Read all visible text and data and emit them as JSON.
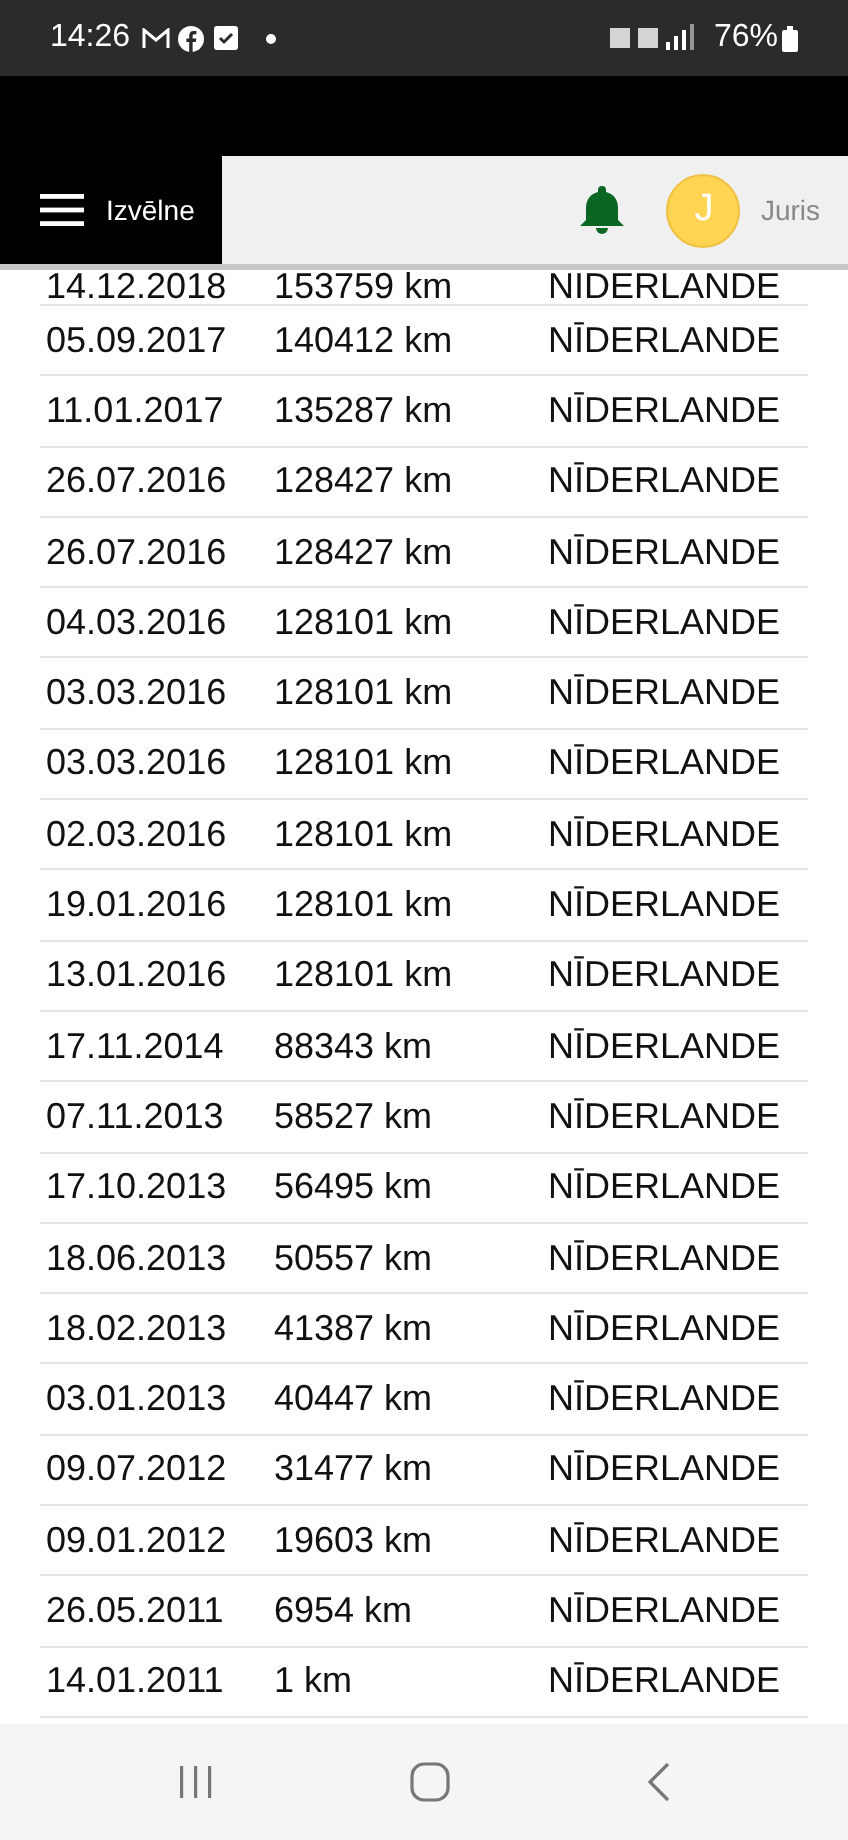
{
  "status_bar": {
    "time": "14:26",
    "battery": "76%"
  },
  "header": {
    "menu_label": "Izvēlne",
    "avatar_initial": "J",
    "user_name": "Juris"
  },
  "rows": [
    {
      "date": "14.12.2018",
      "odometer": "153759 km",
      "country": "NIDERLANDE"
    },
    {
      "date": "05.09.2017",
      "odometer": "140412 km",
      "country": "NĪDERLANDE"
    },
    {
      "date": "11.01.2017",
      "odometer": "135287 km",
      "country": "NĪDERLANDE"
    },
    {
      "date": "26.07.2016",
      "odometer": "128427 km",
      "country": "NĪDERLANDE"
    },
    {
      "date": "26.07.2016",
      "odometer": "128427 km",
      "country": "NĪDERLANDE"
    },
    {
      "date": "04.03.2016",
      "odometer": "128101 km",
      "country": "NĪDERLANDE"
    },
    {
      "date": "03.03.2016",
      "odometer": "128101 km",
      "country": "NĪDERLANDE"
    },
    {
      "date": "03.03.2016",
      "odometer": "128101 km",
      "country": "NĪDERLANDE"
    },
    {
      "date": "02.03.2016",
      "odometer": "128101 km",
      "country": "NĪDERLANDE"
    },
    {
      "date": "19.01.2016",
      "odometer": "128101 km",
      "country": "NĪDERLANDE"
    },
    {
      "date": "13.01.2016",
      "odometer": "128101 km",
      "country": "NĪDERLANDE"
    },
    {
      "date": "17.11.2014",
      "odometer": "88343 km",
      "country": "NĪDERLANDE"
    },
    {
      "date": "07.11.2013",
      "odometer": "58527 km",
      "country": "NĪDERLANDE"
    },
    {
      "date": "17.10.2013",
      "odometer": "56495 km",
      "country": "NĪDERLANDE"
    },
    {
      "date": "18.06.2013",
      "odometer": "50557 km",
      "country": "NĪDERLANDE"
    },
    {
      "date": "18.02.2013",
      "odometer": "41387 km",
      "country": "NĪDERLANDE"
    },
    {
      "date": "03.01.2013",
      "odometer": "40447 km",
      "country": "NĪDERLANDE"
    },
    {
      "date": "09.07.2012",
      "odometer": "31477 km",
      "country": "NĪDERLANDE"
    },
    {
      "date": "09.01.2012",
      "odometer": "19603 km",
      "country": "NĪDERLANDE"
    },
    {
      "date": "26.05.2011",
      "odometer": "6954 km",
      "country": "NĪDERLANDE"
    },
    {
      "date": "14.01.2011",
      "odometer": "1 km",
      "country": "NĪDERLANDE"
    }
  ]
}
